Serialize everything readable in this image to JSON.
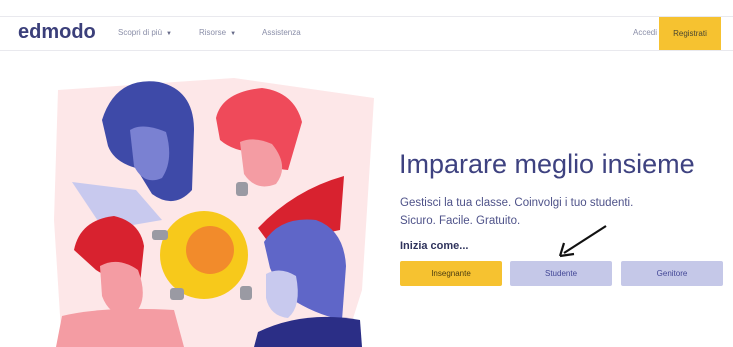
{
  "nav": {
    "logo": "edmodo",
    "items": [
      {
        "label": "Scopri di più",
        "has_caret": true
      },
      {
        "label": "Risorse",
        "has_caret": true
      },
      {
        "label": "Assistenza",
        "has_caret": false
      }
    ],
    "login_label": "Accedi",
    "register_label": "Registrati"
  },
  "hero": {
    "headline": "Imparare meglio insieme",
    "subtext_line1": "Gestisci la tua classe. Coinvolgi i tuo studenti.",
    "subtext_line2": "Sicuro. Facile. Gratuito.",
    "start_label": "Inizia come...",
    "roles": [
      "Insegnante",
      "Studente",
      "Genitore"
    ]
  },
  "colors": {
    "accent": "#f6c230",
    "brand": "#3b3f7a",
    "secondary_button": "#c5c8e8"
  },
  "icons": [
    "caret-down-icon",
    "annotation-arrow-icon"
  ]
}
